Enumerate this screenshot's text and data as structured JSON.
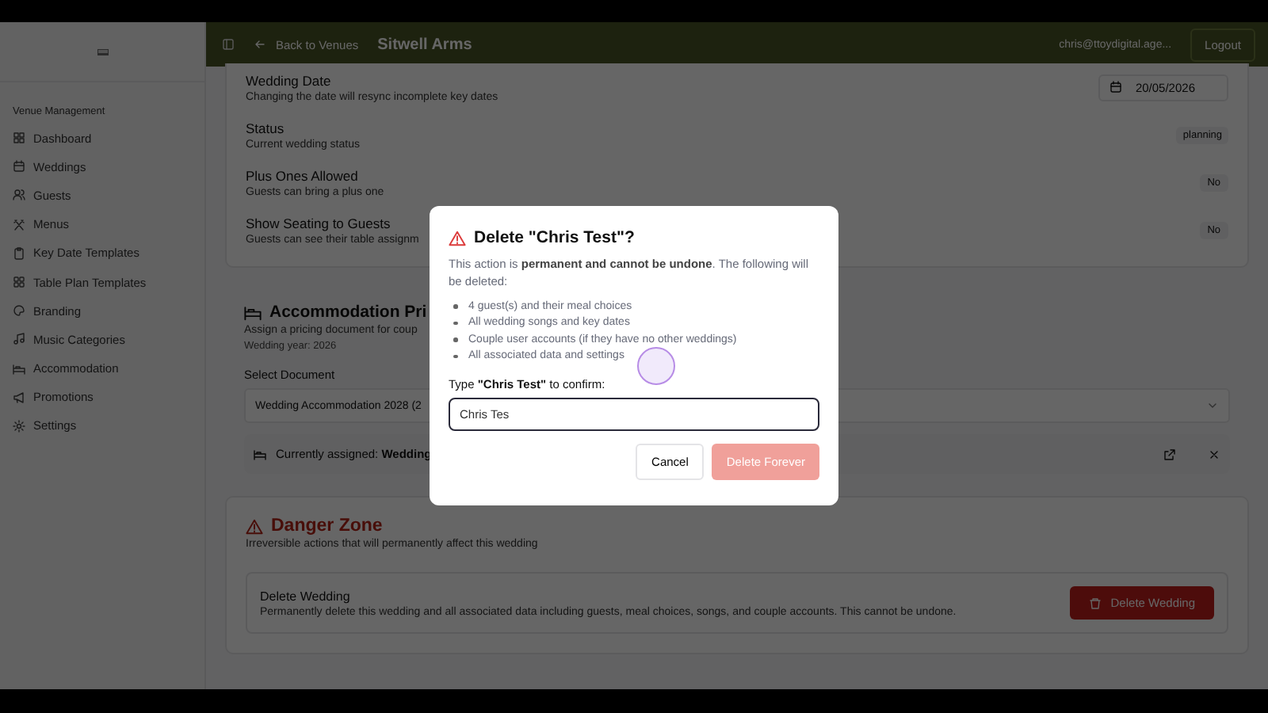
{
  "sidebar": {
    "section_label": "Venue Management",
    "items": [
      {
        "label": "Dashboard"
      },
      {
        "label": "Weddings"
      },
      {
        "label": "Guests"
      },
      {
        "label": "Menus"
      },
      {
        "label": "Key Date Templates"
      },
      {
        "label": "Table Plan Templates"
      },
      {
        "label": "Branding"
      },
      {
        "label": "Music Categories"
      },
      {
        "label": "Accommodation"
      },
      {
        "label": "Promotions"
      },
      {
        "label": "Settings"
      }
    ]
  },
  "header": {
    "back_link": "Back to Venues",
    "title": "Sitwell Arms",
    "user_email": "chris@ttoydigital.age...",
    "logout": "Logout"
  },
  "settings": [
    {
      "title": "Wedding Date",
      "description": "Changing the date will resync incomplete key dates",
      "value": "20/05/2026",
      "kind": "date"
    },
    {
      "title": "Status",
      "description": "Current wedding status",
      "value": "planning",
      "kind": "badge"
    },
    {
      "title": "Plus Ones Allowed",
      "description": "Guests can bring a plus one",
      "value": "No",
      "kind": "pill"
    },
    {
      "title": "Show Seating to Guests",
      "description": "Guests can see their table assignm",
      "value": "No",
      "kind": "pill"
    }
  ],
  "accommodation": {
    "title": "Accommodation Pri",
    "description": "Assign a pricing document for coup",
    "year": "Wedding year: 2026",
    "select_label": "Select Document",
    "select_value": "Wedding Accommodation 2028 (2",
    "assigned": "Currently assigned: **Wedding**"
  },
  "danger_zone": {
    "title": "Danger Zone",
    "description": "Irreversible actions that will permanently affect this wedding",
    "item_title": "Delete Wedding",
    "item_description": "Permanently delete this wedding and all associated data including guests, meal choices, songs, and couple accounts. This cannot be undone.",
    "button": "Delete Wedding"
  },
  "dialog": {
    "title": "Delete \"Chris Test\"?",
    "message": "This action is **permanent and cannot be undone**. The following will be deleted:",
    "items": [
      "4 guest(s) and their meal choices",
      "All wedding songs and key dates",
      "Couple user accounts (if they have no other weddings)",
      "All associated data and settings"
    ],
    "confirm_label": "Type **\"Chris Test\"** to confirm:",
    "input_value": "Chris Tes",
    "cancel": "Cancel",
    "confirm": {
      "label": "Delete Forever",
      "disabled": true
    }
  }
}
